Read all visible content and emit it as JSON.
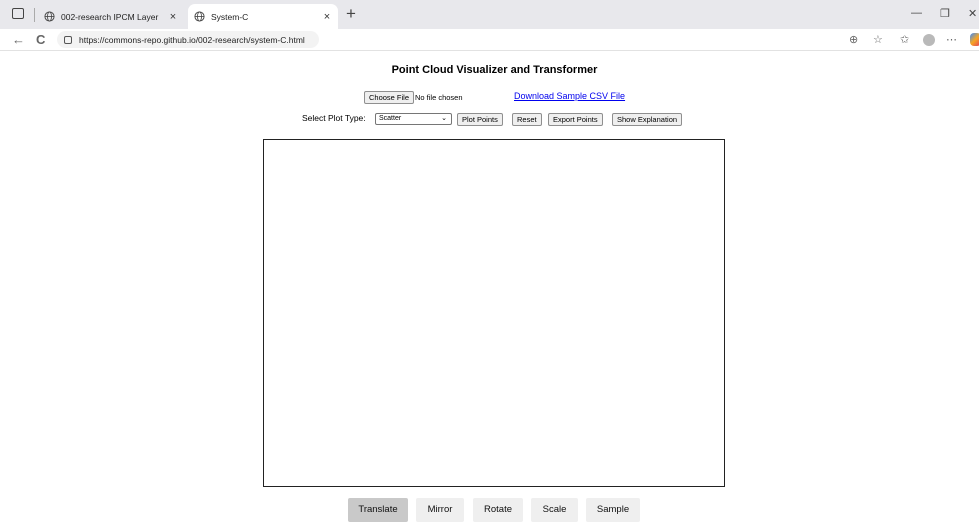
{
  "browser": {
    "tabs": [
      {
        "title": "002-research IPCM Layer",
        "active": false
      },
      {
        "title": "System-C",
        "active": true
      }
    ],
    "new_tab": "+",
    "close_glyph": "×",
    "url": "https://commons-repo.github.io/002-research/system-C.html",
    "controls": {
      "minimize": "—",
      "restore": "❐",
      "close": "✕"
    },
    "toolbar_glyphs": {
      "back": "←",
      "refresh": "C",
      "zoom": "⊕",
      "favorite": "☆",
      "favorites_list": "✩",
      "more": "⋯"
    }
  },
  "page": {
    "title": "Point Cloud Visualizer and Transformer",
    "file_input": {
      "button": "Choose File",
      "status": "No file chosen"
    },
    "download_link": "Download Sample CSV File",
    "plot_type_label": "Select Plot Type:",
    "plot_type_value": "Scatter",
    "buttons": {
      "plot": "Plot Points",
      "reset": "Reset",
      "export": "Export Points",
      "explanation": "Show Explanation"
    },
    "transform_tabs": [
      {
        "label": "Translate",
        "selected": true
      },
      {
        "label": "Mirror",
        "selected": false
      },
      {
        "label": "Rotate",
        "selected": false
      },
      {
        "label": "Scale",
        "selected": false
      },
      {
        "label": "Sample",
        "selected": false
      }
    ]
  },
  "colors": {
    "link": "#0000ee",
    "chrome": "#e8e8ec",
    "selected_tab": "#c9c9c9"
  }
}
